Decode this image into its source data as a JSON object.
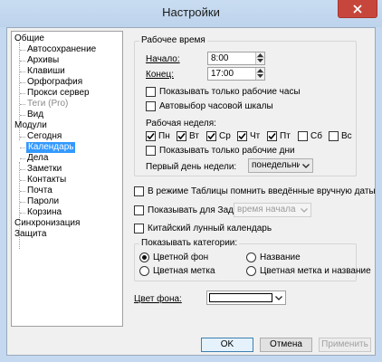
{
  "window": {
    "title": "Настройки"
  },
  "colors": {
    "accent": "#3399ff",
    "close_button": "#c7463c"
  },
  "sidebar": {
    "items": [
      {
        "label": "Общие"
      },
      {
        "label": "Автосохранение"
      },
      {
        "label": "Архивы"
      },
      {
        "label": "Клавиши"
      },
      {
        "label": "Орфография"
      },
      {
        "label": "Прокси сервер"
      },
      {
        "label": "Теги (Pro)"
      },
      {
        "label": "Вид"
      },
      {
        "label": "Модули"
      },
      {
        "label": "Сегодня"
      },
      {
        "label": "Календарь"
      },
      {
        "label": "Дела"
      },
      {
        "label": "Заметки"
      },
      {
        "label": "Контакты"
      },
      {
        "label": "Почта"
      },
      {
        "label": "Пароли"
      },
      {
        "label": "Корзина"
      },
      {
        "label": "Синхронизация"
      },
      {
        "label": "Защита"
      }
    ]
  },
  "work_time": {
    "group_label": "Рабочее время",
    "start_label": "Начало:",
    "start_value": "8:00",
    "end_label": "Конец:",
    "end_value": "17:00",
    "show_work_hours_label": "Показывать только рабочие часы",
    "auto_scale_label": "Автовыбор часовой шкалы",
    "work_week_label": "Рабочая неделя:",
    "days": [
      {
        "label": "Пн",
        "checked": true
      },
      {
        "label": "Вт",
        "checked": true
      },
      {
        "label": "Ср",
        "checked": true
      },
      {
        "label": "Чт",
        "checked": true
      },
      {
        "label": "Пт",
        "checked": true
      },
      {
        "label": "Сб",
        "checked": false
      },
      {
        "label": "Вс",
        "checked": false
      }
    ],
    "show_work_days_label": "Показывать только рабочие дни",
    "first_day_label": "Первый день недели:",
    "first_day_value": "понедельник"
  },
  "options": {
    "table_mode_label": "В режиме Таблицы помнить введённые вручную даты",
    "show_for_tasks_label": "Показывать для Задач:",
    "show_for_tasks_value": "время начала и ко",
    "lunar_calendar_label": "Китайский лунный календарь"
  },
  "categories": {
    "group_label": "Показывать категории:",
    "options": [
      {
        "label": "Цветной фон",
        "selected": true
      },
      {
        "label": "Название",
        "selected": false
      },
      {
        "label": "Цветная метка",
        "selected": false
      },
      {
        "label": "Цветная метка и название",
        "selected": false
      }
    ]
  },
  "background": {
    "label": "Цвет фона:",
    "color": "#ffffff"
  },
  "footer": {
    "ok_label": "OK",
    "cancel_label": "Отмена",
    "apply_label": "Применить"
  }
}
